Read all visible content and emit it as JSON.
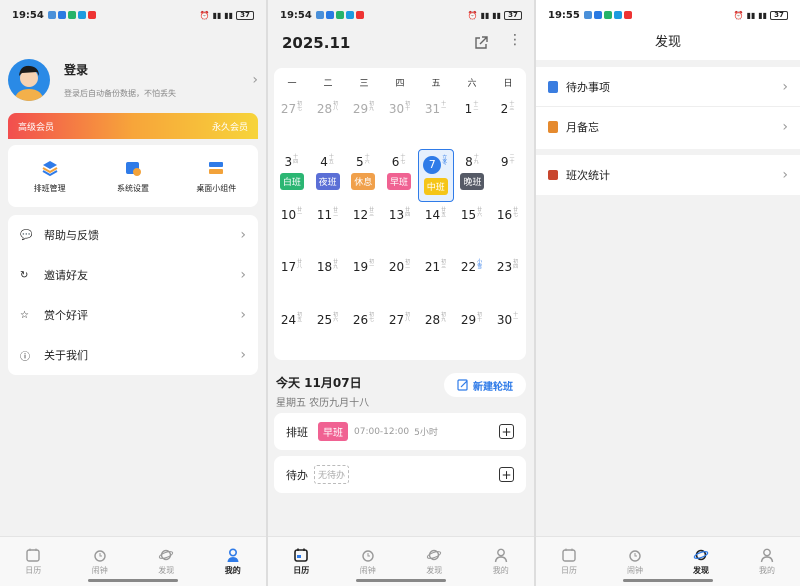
{
  "status": {
    "s1_time": "19:54",
    "s2_time": "19:54",
    "s3_time": "19:55",
    "battery": "37"
  },
  "profile": {
    "title": "登录",
    "subtitle": "登录后自动备份数据，不怕丢失",
    "vip_label": "高级会员",
    "vip_value": "永久会员",
    "quick_actions": [
      "排班管理",
      "系统设置",
      "桌面小组件"
    ],
    "menu": [
      "帮助与反馈",
      "邀请好友",
      "赏个好评",
      "关于我们"
    ]
  },
  "tabs": [
    "日历",
    "闹钟",
    "发现",
    "我的"
  ],
  "calendar": {
    "month": "2025.11",
    "weekdays": [
      "一",
      "二",
      "三",
      "四",
      "五",
      "六",
      "日"
    ],
    "weeks": [
      [
        [
          "27",
          "初七"
        ],
        [
          "28",
          "初八"
        ],
        [
          "29",
          "初九"
        ],
        [
          "30",
          "初十"
        ],
        [
          "31",
          "十一"
        ],
        [
          "1",
          "十二"
        ],
        [
          "2",
          "十三"
        ]
      ],
      [
        [
          "3",
          "十四"
        ],
        [
          "4",
          "十五"
        ],
        [
          "5",
          "十六"
        ],
        [
          "6",
          "十七"
        ],
        [
          "7",
          "立冬"
        ],
        [
          "8",
          "十九"
        ],
        [
          "9",
          "二十"
        ]
      ],
      [
        [
          "10",
          "廿一"
        ],
        [
          "11",
          "廿二"
        ],
        [
          "12",
          "廿三"
        ],
        [
          "13",
          "廿四"
        ],
        [
          "14",
          "廿五"
        ],
        [
          "15",
          "廿六"
        ],
        [
          "16",
          "廿七"
        ]
      ],
      [
        [
          "17",
          "廿八"
        ],
        [
          "18",
          "廿九"
        ],
        [
          "19",
          "初一"
        ],
        [
          "20",
          "初二"
        ],
        [
          "21",
          "初三"
        ],
        [
          "22",
          "小雪"
        ],
        [
          "23",
          "初四"
        ]
      ],
      [
        [
          "24",
          "初五"
        ],
        [
          "25",
          "初六"
        ],
        [
          "26",
          "初七"
        ],
        [
          "27",
          "初八"
        ],
        [
          "28",
          "初九"
        ],
        [
          "29",
          "初十"
        ],
        [
          "30",
          "十一"
        ]
      ]
    ],
    "shifts": [
      {
        "label": "白班",
        "color": "#2bb673"
      },
      {
        "label": "夜班",
        "color": "#5b6fd6"
      },
      {
        "label": "休息",
        "color": "#f0a04b"
      },
      {
        "label": "早班",
        "color": "#f06292"
      },
      {
        "label": "中班",
        "color": "#f5c518"
      },
      {
        "label": "晚班",
        "color": "#555a66"
      }
    ],
    "today_title": "今天 11月07日",
    "today_sub": "星期五 农历九月十八",
    "new_rotation": "新建轮班",
    "shift_row_label": "排班",
    "shift_badge": "早班",
    "shift_time": "07:00-12:00",
    "shift_hours": "5小时",
    "todo_label": "待办",
    "todo_placeholder": "无待办"
  },
  "discover": {
    "title": "发现",
    "items": [
      "待办事项",
      "月备忘"
    ],
    "items2": [
      "班次统计"
    ]
  }
}
